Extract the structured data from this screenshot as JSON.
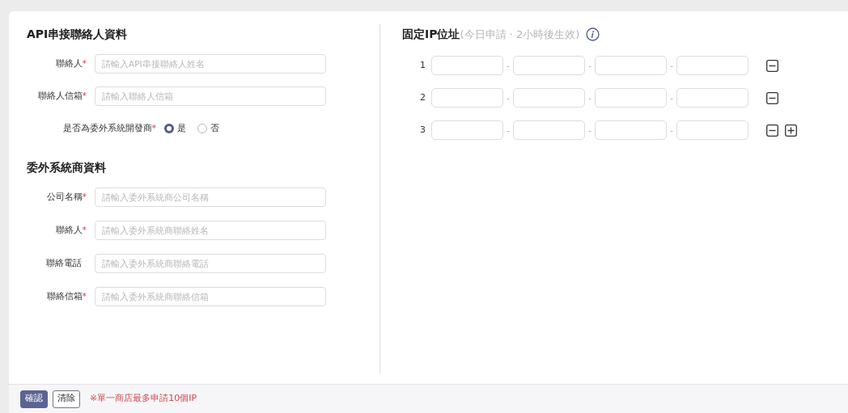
{
  "sections": [
    {
      "title": "API串接聯絡人資料",
      "fields": [
        {
          "kind": "text",
          "label": "聯絡人",
          "mark": "*",
          "placeholder": "請輸入API串接聯絡人姓名"
        },
        {
          "kind": "text",
          "label": "聯絡人信箱",
          "mark": "*",
          "placeholder": "請輸入聯絡人信箱"
        },
        {
          "kind": "radio",
          "label": "是否為委外系統開發商",
          "mark": "*",
          "options": [
            {
              "label": "是",
              "selected": true
            },
            {
              "label": "否",
              "selected": false
            }
          ]
        }
      ]
    },
    {
      "title": "委外系統商資料",
      "fields": [
        {
          "kind": "text",
          "label": "公司名稱",
          "mark": "*",
          "placeholder": "請輸入委外系統商公司名稱"
        },
        {
          "kind": "text",
          "label": "聯絡人",
          "mark": "*",
          "placeholder": "請輸入委外系統商聯絡姓名"
        },
        {
          "kind": "text",
          "label": "聯絡電話",
          "placeholder": "請輸入委外系統商聯絡電話"
        },
        {
          "kind": "text",
          "label": "聯絡信箱",
          "mark": "*",
          "placeholder": "請輸入委外系統商聯絡信箱"
        }
      ]
    }
  ],
  "ip_section": {
    "title": "固定IP位址",
    "note": "(今日申請 · 2小時後生效)",
    "rows": [
      {
        "number": "1",
        "separators": [
          "-",
          "-",
          "-"
        ],
        "can_remove": true,
        "can_add": false
      },
      {
        "number": "2",
        "separators": [
          "-",
          "-",
          "-"
        ],
        "can_remove": true,
        "can_add": false
      },
      {
        "number": "3",
        "separators": [
          "-",
          "-",
          "-"
        ],
        "can_remove": true,
        "can_add": true
      }
    ]
  },
  "footer": {
    "buttons": [
      {
        "label": "確認",
        "kind": "primary"
      },
      {
        "label": "清除",
        "kind": "outline"
      }
    ],
    "notice": "※單一商店最多申請10個IP"
  }
}
